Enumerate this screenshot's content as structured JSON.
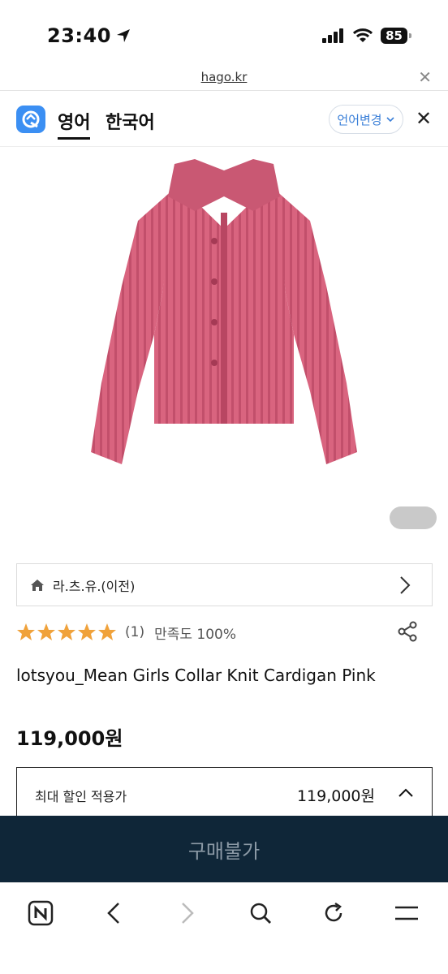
{
  "status_bar": {
    "time": "23:40",
    "battery": "85"
  },
  "browser": {
    "url": "hago.kr"
  },
  "translate_bar": {
    "tab_english": "영어",
    "tab_korean": "한국어",
    "change_language_label": "언어변경"
  },
  "product": {
    "shop_name": "라.츠.유.(이전)",
    "rating_count": "(1)",
    "satisfaction": "만족도 100%",
    "rating_stars": 5,
    "title": "lotsyou_Mean Girls Collar Knit Cardigan Pink",
    "price": "119,000원",
    "discount_label": "최대 할인 적용가",
    "discount_price": "119,000원"
  },
  "buy_bar": {
    "label": "구매불가"
  },
  "colors": {
    "star": "#f0a23b",
    "buy_bar_bg": "#0f2638",
    "accent": "#3b8ff3",
    "cardigan": "#d9647f"
  }
}
